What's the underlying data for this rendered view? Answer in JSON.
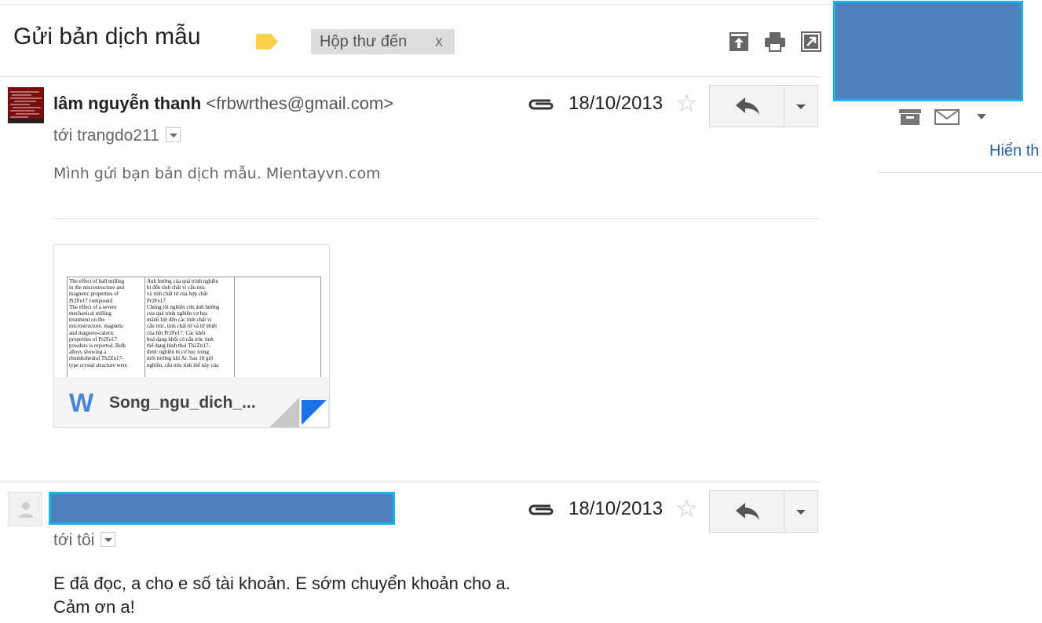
{
  "thread": {
    "subject": "Gửi bản dịch mẫu",
    "label_chip": "Hộp thư đến",
    "label_chip_close": "x"
  },
  "toolbar": {
    "icons": [
      "archive-up-icon",
      "print-icon",
      "new-window-icon"
    ]
  },
  "messages": [
    {
      "sender_name": "lâm nguyễn thanh",
      "sender_email": "<frbwrthes@gmail.com>",
      "to_line": "tới trangdo211",
      "date": "18/10/2013",
      "body": "Mình gửi bạn bản dịch mẫu. Mientayvn.com",
      "attachment": {
        "file_name": "Song_ngu_dich_...",
        "type_letter": "W",
        "preview_left": "The effect of ball milling\nin the microstructure and\nmagnetic properties of\nPr2Fe17 compound\nThe effect of a severe\nmechanical milling\ntreatment on the\nmicrostructure, magnetic\nand magneto-caloric\nproperties of Pr2Fe17\npowders is reported. Bulk\nalloys showing a\nrhombohedral Th2Zn17-\ntype crystal structure were",
        "preview_right": "Ảnh hưởng của quá trình nghiền\nbi đến tính chất vi cấu trúc\nvà tính chất từ của hợp chất\nPr2Fe17\nChúng tôi nghiên cứu ảnh hưởng\ncủa quá trình nghiền cơ học\nmãnh liệt đến các tính chất vi\ncấu trúc, tính chất từ và từ nhiệt\ncủa bột Pr2Fe17. Các khối\nhoá dạng khối có cấu trúc tinh\nthể dạng hình thoi Th2Zn17-\nđược nghiền bi cơ học trong\nmôi trường khí Ar. Sau 10 giờ\nnghiền, cấu trúc tinh thể này của"
      }
    },
    {
      "to_line": "tới tôi",
      "date": "18/10/2013",
      "body_lines": [
        "E đã đọc, a cho e số tài khoản. E sớm chuyển khoản cho a.",
        "Cảm ơn a!"
      ]
    }
  ],
  "sidebar": {
    "show_link": "Hiển th"
  },
  "colors": {
    "redaction_fill": "#4f81bd",
    "redaction_border": "#14b4f0",
    "label_tag": "#f9d24a",
    "link": "#2a5db0"
  }
}
